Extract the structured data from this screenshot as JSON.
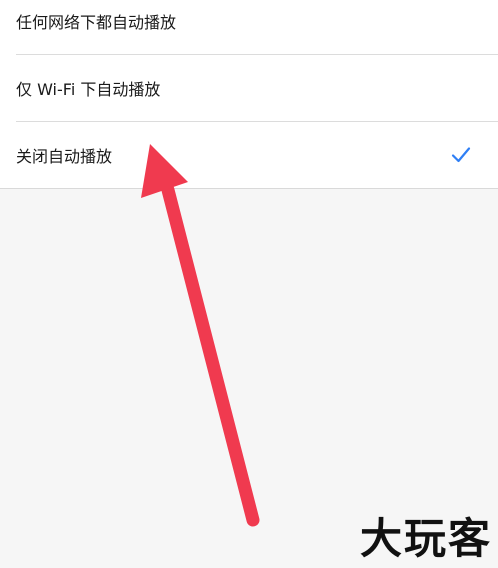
{
  "autoplay_options": {
    "items": [
      {
        "label": "任何网络下都自动播放",
        "selected": false
      },
      {
        "label": "仅 Wi-Fi 下自动播放",
        "selected": false
      },
      {
        "label": "关闭自动播放",
        "selected": true
      }
    ],
    "check_icon": "checkmark-icon",
    "accent_color": "#2f7ff5"
  },
  "annotation": {
    "icon": "red-arrow-annotation",
    "color": "#f03a4f"
  },
  "watermark": {
    "text": "大玩客"
  }
}
